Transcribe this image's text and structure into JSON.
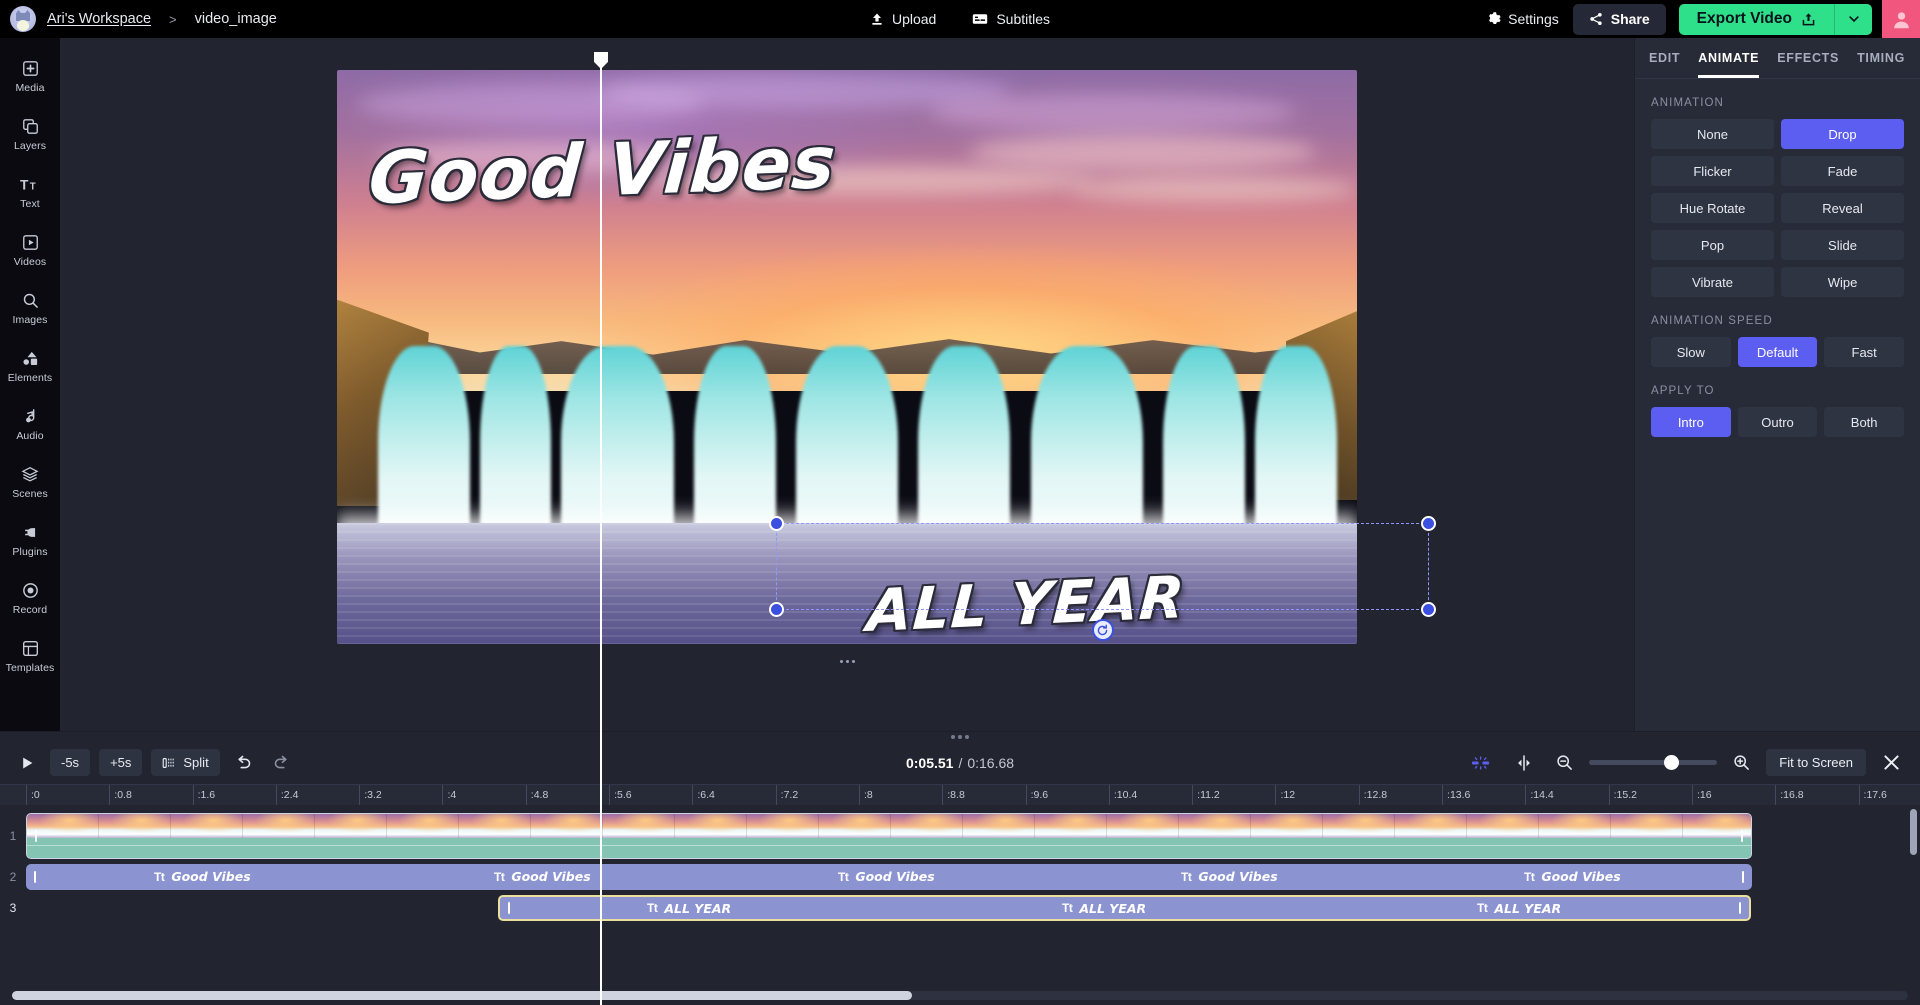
{
  "header": {
    "workspace": "Ari's Workspace",
    "separator": ">",
    "project": "video_image",
    "upload_label": "Upload",
    "subtitles_label": "Subtitles",
    "settings_label": "Settings",
    "share_label": "Share",
    "export_label": "Export Video",
    "accent_green": "#2fe08a",
    "avatar_color": "#f1567f"
  },
  "sidebar": {
    "items": [
      {
        "label": "Media",
        "icon": "media-icon"
      },
      {
        "label": "Layers",
        "icon": "layers-icon"
      },
      {
        "label": "Text",
        "icon": "text-icon"
      },
      {
        "label": "Videos",
        "icon": "videos-icon"
      },
      {
        "label": "Images",
        "icon": "images-search-icon"
      },
      {
        "label": "Elements",
        "icon": "elements-icon"
      },
      {
        "label": "Audio",
        "icon": "audio-note-icon"
      },
      {
        "label": "Scenes",
        "icon": "scenes-stack-icon"
      },
      {
        "label": "Plugins",
        "icon": "plugins-plug-icon"
      },
      {
        "label": "Record",
        "icon": "record-icon"
      },
      {
        "label": "Templates",
        "icon": "templates-icon"
      }
    ]
  },
  "canvas": {
    "text_top": "Good Vibes",
    "text_bottom": "ALL YEAR",
    "selected_layer": "ALL YEAR"
  },
  "right_panel": {
    "tabs": [
      {
        "label": "EDIT",
        "active": false
      },
      {
        "label": "ANIMATE",
        "active": true
      },
      {
        "label": "EFFECTS",
        "active": false
      },
      {
        "label": "TIMING",
        "active": false
      }
    ],
    "animation": {
      "title": "ANIMATION",
      "options": [
        "None",
        "Drop",
        "Flicker",
        "Fade",
        "Hue Rotate",
        "Reveal",
        "Pop",
        "Slide",
        "Vibrate",
        "Wipe"
      ],
      "selected": "Drop"
    },
    "animation_speed": {
      "title": "ANIMATION SPEED",
      "options": [
        "Slow",
        "Default",
        "Fast"
      ],
      "selected": "Default"
    },
    "apply_to": {
      "title": "APPLY TO",
      "options": [
        "Intro",
        "Outro",
        "Both"
      ],
      "selected": "Intro"
    },
    "accent_blue": "#5b5ef0"
  },
  "timeline": {
    "controls": {
      "play": "play-icon",
      "back_label": "-5s",
      "forward_label": "+5s",
      "split_label": "Split",
      "undo": "undo-icon",
      "redo": "redo-icon",
      "fit_label": "Fit to Screen"
    },
    "current_time": "0:05.51",
    "time_separator": "/",
    "total_time": "0:16.68",
    "ruler_ticks": [
      ":0",
      ":0.8",
      ":1.6",
      ":2.4",
      ":3.2",
      ":4",
      ":4.8",
      ":5.6",
      ":6.4",
      ":7.2",
      ":8",
      ":8.8",
      ":9.6",
      ":10.4",
      ":11.2",
      ":12",
      ":12.8",
      ":13.6",
      ":14.4",
      ":15.2",
      ":16",
      ":16.8",
      ":17.6"
    ],
    "playhead_time": ":5.51",
    "zoom_level": 64,
    "tracks": [
      {
        "number": "1",
        "type": "video",
        "label": "",
        "selected": false
      },
      {
        "number": "2",
        "type": "text",
        "label": "Good Vibes",
        "icon": "Tt",
        "selected": false,
        "repeats": 5
      },
      {
        "number": "3",
        "type": "text",
        "label": "ALL YEAR",
        "icon": "Tt",
        "selected": true,
        "repeats": 3
      }
    ]
  }
}
